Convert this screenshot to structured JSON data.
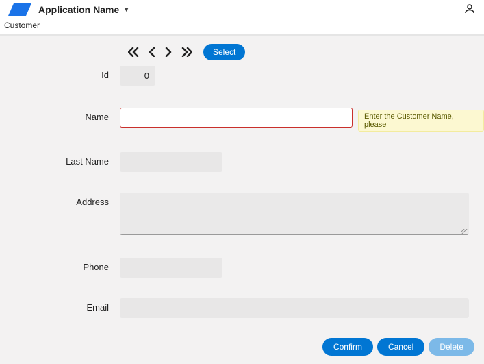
{
  "header": {
    "app_title": "Application Name"
  },
  "tab": {
    "label": "Customer"
  },
  "toolbar": {
    "select_label": "Select"
  },
  "form": {
    "id_label": "Id",
    "id_value": "0",
    "name_label": "Name",
    "name_value": "",
    "name_hint": "Enter the Customer Name, please",
    "lastname_label": "Last Name",
    "lastname_value": "",
    "address_label": "Address",
    "address_value": "",
    "phone_label": "Phone",
    "phone_value": "",
    "email_label": "Email",
    "email_value": ""
  },
  "footer": {
    "confirm_label": "Confirm",
    "cancel_label": "Cancel",
    "delete_label": "Delete"
  }
}
